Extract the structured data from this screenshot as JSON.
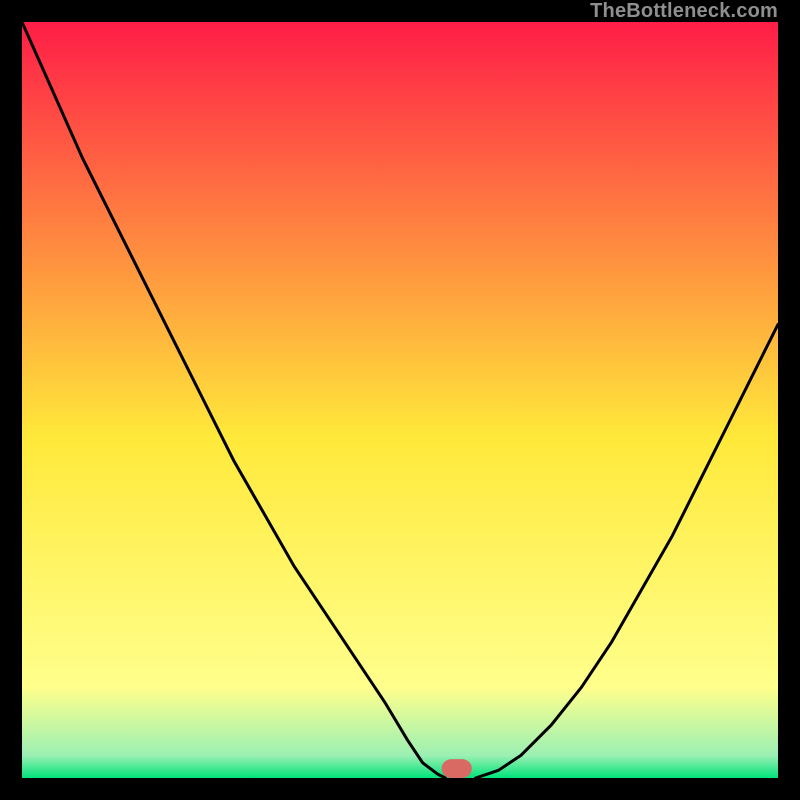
{
  "attribution": "TheBottleneck.com",
  "chart_data": {
    "type": "line",
    "title": "",
    "xlabel": "",
    "ylabel": "",
    "xlim": [
      0,
      100
    ],
    "ylim": [
      0,
      100
    ],
    "grid": false,
    "legend": false,
    "background_gradient": {
      "top": "#ff1d47",
      "mid": "#ffe93a",
      "bottom": "#00e37a",
      "band_top": "#ffff8c",
      "band_bottom": "#9cf0b3"
    },
    "series": [
      {
        "name": "curve-left",
        "x": [
          0,
          4,
          8,
          12,
          16,
          20,
          24,
          28,
          32,
          36,
          40,
          44,
          48,
          51,
          53,
          55,
          56
        ],
        "y": [
          100,
          91,
          82,
          74,
          66,
          58,
          50,
          42,
          35,
          28,
          22,
          16,
          10,
          5,
          2,
          0.5,
          0
        ]
      },
      {
        "name": "curve-right",
        "x": [
          60,
          63,
          66,
          70,
          74,
          78,
          82,
          86,
          90,
          94,
          98,
          100
        ],
        "y": [
          0,
          1,
          3,
          7,
          12,
          18,
          25,
          32,
          40,
          48,
          56,
          60
        ]
      }
    ],
    "marker": {
      "x": 57.5,
      "y": 0,
      "width": 4,
      "height": 2.5,
      "color": "#d96a63",
      "rx": 1.3
    }
  }
}
